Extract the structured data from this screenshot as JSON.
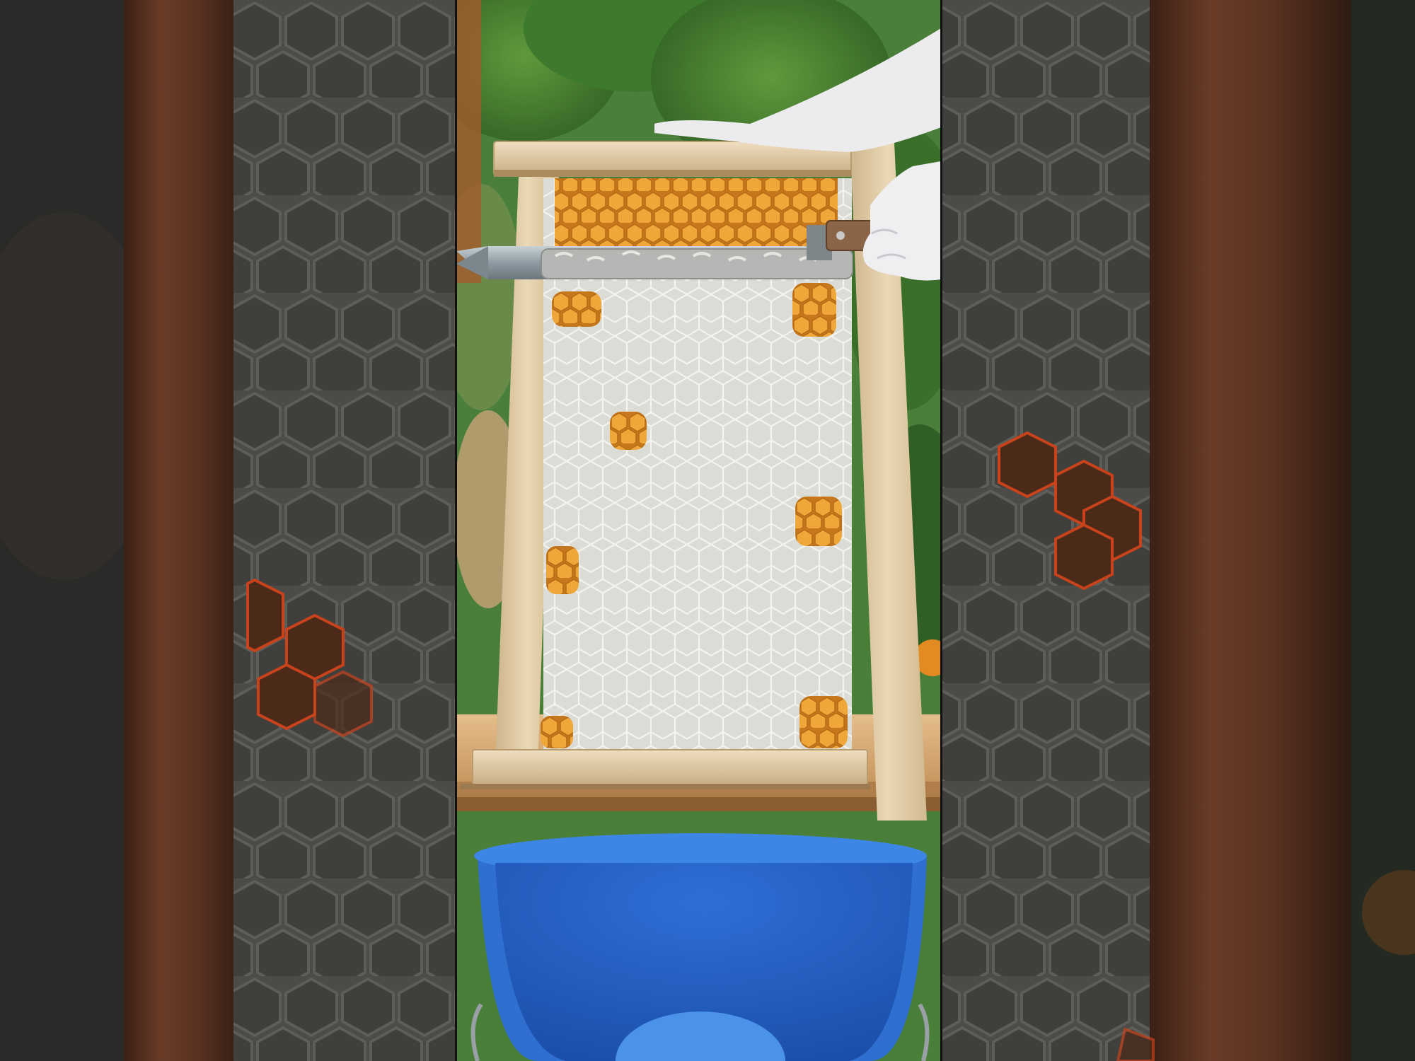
{
  "scene": {
    "type": "mobile-game-screen-recording",
    "description_free": true,
    "colors": {
      "letterbox_dark": "#1d1e1c",
      "blurred_wood": "#5a3422",
      "blurred_comb": "#4a4a48",
      "foliage": "#3f7a2e",
      "frame_wood": "#e2cfab",
      "honey_cell": "#e39a2c",
      "wax_cap": "#dcdcd8",
      "knife_blade": "#9aa6ac",
      "knife_handle": "#8a6446",
      "glove": "#ecebee",
      "table_wood": "#d9b07e",
      "bucket": "#2f6fd0"
    },
    "icons": [
      "uncapping-knife-icon",
      "glove-icon",
      "bucket-icon",
      "honeycomb-frame-icon"
    ],
    "progress": {
      "uncapped_rows_fraction": 0.12,
      "remaining_exposed_patches": 8
    }
  }
}
